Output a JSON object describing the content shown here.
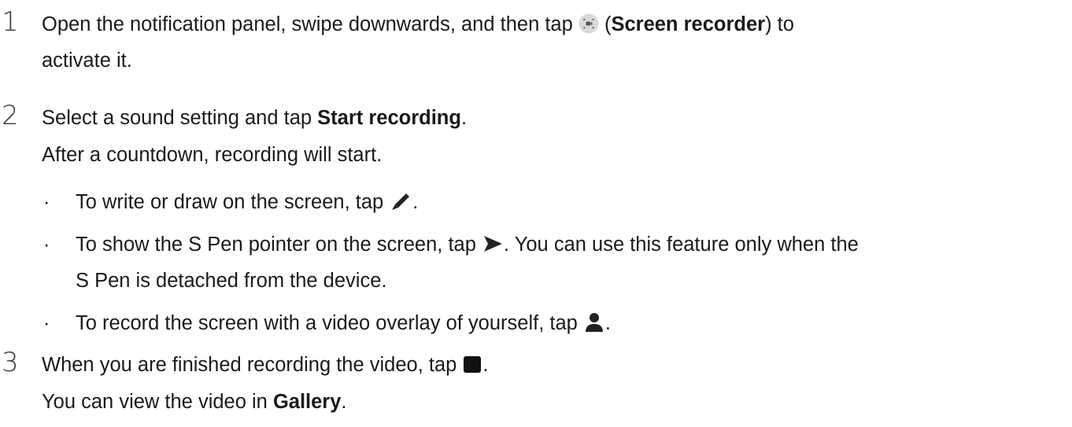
{
  "steps": [
    {
      "number": "1",
      "line1_pre": "Open the notification panel, swipe downwards, and then tap ",
      "line1_paren_open": " (",
      "line1_bold": "Screen recorder",
      "line1_post": ") to",
      "line2": "activate it."
    },
    {
      "number": "2",
      "line1_pre": "Select a sound setting and tap ",
      "line1_bold": "Start recording",
      "line1_post": ".",
      "line2": "After a countdown, recording will start.",
      "bullets": [
        {
          "pre": "To write or draw on the screen, tap ",
          "post": "."
        },
        {
          "pre": "To show the S Pen pointer on the screen, tap ",
          "post": ". You can use this feature only when the",
          "cont": "S Pen is detached from the device."
        },
        {
          "pre": "To record the screen with a video overlay of yourself, tap ",
          "post": "."
        }
      ]
    },
    {
      "number": "3",
      "line1_pre": "When you are finished recording the video, tap ",
      "line1_post": ".",
      "line2_pre": "You can view the video in ",
      "line2_bold": "Gallery",
      "line2_post": "."
    }
  ],
  "bullet_char": "·",
  "icons": {
    "screen_recorder": "screen-recorder-icon",
    "pen": "pen-icon",
    "pointer": "pointer-icon",
    "person": "person-icon",
    "stop": "stop-icon"
  },
  "colors": {
    "text": "#1a1a1a",
    "step_number": "#3a3a3a",
    "icon_circle": "#d9d9d9",
    "icon_dark": "#222222"
  }
}
